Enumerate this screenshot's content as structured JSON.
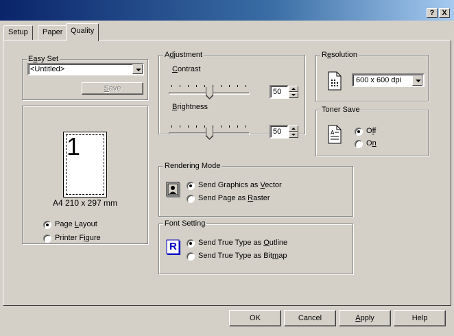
{
  "titlebar": {
    "help_glyph": "?",
    "close_glyph": "X"
  },
  "tabs": [
    {
      "label": "Setup"
    },
    {
      "label": "Paper"
    },
    {
      "label": "Quality"
    }
  ],
  "easy_set": {
    "title_pre": "E",
    "title_u": "a",
    "title_post": "sy Set",
    "selected": "<Untitled>",
    "save_u": "S",
    "save_post": "ave"
  },
  "preview": {
    "page_number": "1",
    "paper_label": "A4 210 x 297 mm",
    "options": [
      {
        "pre": "Page ",
        "u": "L",
        "post": "ayout",
        "checked": true
      },
      {
        "pre": "Printer F",
        "u": "i",
        "post": "gure",
        "checked": false
      }
    ]
  },
  "adjustment": {
    "title_pre": "A",
    "title_u": "d",
    "title_post": "justment",
    "contrast": {
      "label_u": "C",
      "label_post": "ontrast",
      "value": "50"
    },
    "brightness": {
      "label_u": "B",
      "label_post": "rightness",
      "value": "50"
    }
  },
  "resolution": {
    "title_pre": "R",
    "title_u": "e",
    "title_post": "solution",
    "selected": "600 x 600 dpi"
  },
  "toner_save": {
    "title": "Toner Save",
    "options": [
      {
        "pre": "O",
        "u": "f",
        "post": "f",
        "checked": true
      },
      {
        "pre": "O",
        "u": "n",
        "post": "",
        "checked": false
      }
    ]
  },
  "rendering_mode": {
    "title": "Rendering Mode",
    "options": [
      {
        "pre": "Send Graphics as ",
        "u": "V",
        "post": "ector",
        "checked": true
      },
      {
        "pre": "Send Page as ",
        "u": "R",
        "post": "aster",
        "checked": false
      }
    ]
  },
  "font_setting": {
    "title": "Font Setting",
    "icon_letter": "R",
    "options": [
      {
        "pre": "Send True Type as ",
        "u": "O",
        "post": "utline",
        "checked": true
      },
      {
        "pre": "Send True Type as Bit",
        "u": "m",
        "post": "ap",
        "checked": false
      }
    ]
  },
  "footer": {
    "ok": "OK",
    "cancel": "Cancel",
    "apply_u": "A",
    "apply_post": "pply",
    "help": "Help"
  },
  "colors": {
    "title_start": "#0a246a",
    "title_end": "#a6caf0",
    "face": "#d4d0c8",
    "font_icon": "#0000c0"
  }
}
